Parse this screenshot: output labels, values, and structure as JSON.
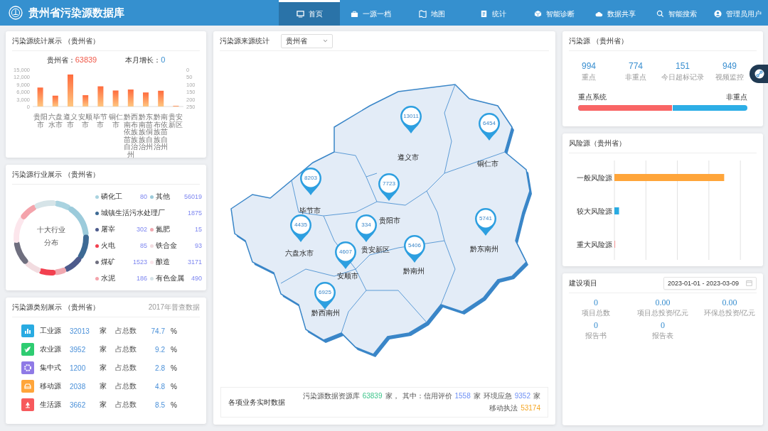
{
  "header": {
    "title": "贵州省污染源数据库",
    "nav": [
      {
        "label": "首页",
        "selected": true
      },
      {
        "label": "一源一档",
        "selected": false
      },
      {
        "label": "地图",
        "selected": false
      },
      {
        "label": "统计",
        "selected": false
      },
      {
        "label": "智能诊断",
        "selected": false
      },
      {
        "label": "数据共享",
        "selected": false
      },
      {
        "label": "智能搜索",
        "selected": false
      },
      {
        "label": "管理员用户",
        "selected": false
      }
    ]
  },
  "source_stats": {
    "title": "污染源统计展示 （贵州省）",
    "total_label": "贵州省：",
    "total": "63839",
    "growth_label": "本月增长：",
    "growth": "0",
    "chart_data": {
      "type": "bar",
      "categories": [
        "贵阳市",
        "六盘水市",
        "遵义市",
        "安顺市",
        "毕节市",
        "铜仁市",
        "黔西南布依族苗族自治州",
        "黔东南苗族侗族自治州",
        "黔南布依族苗族自治州",
        "贵安新区"
      ],
      "values": [
        7700,
        4400,
        13000,
        4600,
        8200,
        6500,
        6900,
        5700,
        6400,
        300
      ],
      "ylim": [
        0,
        15000
      ],
      "yticks": [
        {
          "value": 0,
          "label": "0"
        },
        {
          "value": 3000,
          "label": "3,000"
        },
        {
          "value": 6000,
          "label": "6,000"
        },
        {
          "value": 9000,
          "label": "9,000"
        },
        {
          "value": 12000,
          "label": "12,000"
        },
        {
          "value": 15000,
          "label": "15,000"
        }
      ]
    },
    "right_axis_ticks": [
      "0",
      "50",
      "100",
      "150",
      "200",
      "250"
    ]
  },
  "industry": {
    "title": "污染源行业展示 （贵州省）",
    "center_label": [
      "十大行业",
      "分布"
    ],
    "legend_rows": [
      [
        {
          "name": "磷化工",
          "value": "80",
          "color": "#a9d3e0"
        },
        {
          "name": "其他",
          "value": "56019",
          "color": "#9ccbdb"
        }
      ],
      [
        {
          "name": "城镇生活污水处理厂",
          "value": "1875",
          "color": "#3d6a94"
        }
      ],
      [
        {
          "name": "屠宰",
          "value": "302",
          "color": "#4d5b8c"
        },
        {
          "name": "氮肥",
          "value": "15",
          "color": "#f0a8b0"
        }
      ],
      [
        {
          "name": "火电",
          "value": "85",
          "color": "#f2404f"
        },
        {
          "name": "铁合金",
          "value": "93",
          "color": "#f2dce0"
        }
      ],
      [
        {
          "name": "煤矿",
          "value": "1523",
          "color": "#6f6f7f"
        },
        {
          "name": "酿造",
          "value": "3171",
          "color": "#fce6ec"
        }
      ],
      [
        {
          "name": "水泥",
          "value": "186",
          "color": "#f4a3ab"
        },
        {
          "name": "有色金属",
          "value": "490",
          "color": "#d6e4e8"
        }
      ]
    ]
  },
  "categories": {
    "title": "污染源类别展示 （贵州省）",
    "note": "2017年普查数据",
    "items": [
      {
        "name": "工业源",
        "count": "32013",
        "unit": "家",
        "share_label": "占总数",
        "share": "74.7",
        "percent": "%",
        "color": "#29abe2"
      },
      {
        "name": "农业源",
        "count": "3952",
        "unit": "家",
        "share_label": "占总数",
        "share": "9.2",
        "percent": "%",
        "color": "#2ecc71"
      },
      {
        "name": "集中式",
        "count": "1200",
        "unit": "家",
        "share_label": "占总数",
        "share": "2.8",
        "percent": "%",
        "color": "#8f7ae6"
      },
      {
        "name": "移动源",
        "count": "2038",
        "unit": "家",
        "share_label": "占总数",
        "share": "4.8",
        "percent": "%",
        "color": "#ffa53a"
      },
      {
        "name": "生活源",
        "count": "3662",
        "unit": "家",
        "share_label": "占总数",
        "share": "8.5",
        "percent": "%",
        "color": "#f7595c"
      }
    ]
  },
  "map": {
    "title": "污染源来源统计",
    "region_select": "贵州省",
    "cities": [
      {
        "name": "遵义市",
        "count": "13011"
      },
      {
        "name": "铜仁市",
        "count": "6454"
      },
      {
        "name": "毕节市",
        "count": "8203"
      },
      {
        "name": "贵阳市",
        "count": "7723"
      },
      {
        "name": "六盘水市",
        "count": "4435"
      },
      {
        "name": "贵安新区",
        "count": "334"
      },
      {
        "name": "安顺市",
        "count": "4607"
      },
      {
        "name": "黔南州",
        "count": "5406"
      },
      {
        "name": "黔东南州",
        "count": "5741"
      },
      {
        "name": "黔西南州",
        "count": "6925"
      }
    ],
    "footer": {
      "label": "各项业务实时数据",
      "items": [
        {
          "label": "污染源数据资源库",
          "value": "63839",
          "unit": "家，",
          "color": "#3cc48a"
        },
        {
          "label": "其中：信用评价",
          "value": "1558",
          "unit": "家",
          "color": "#6c8ff5"
        },
        {
          "label": "环境应急",
          "value": "9352",
          "unit": "家",
          "color": "#6c8ff5"
        },
        {
          "label": "移动执法",
          "value": "53174",
          "color": "#f5a623"
        }
      ]
    }
  },
  "pollution_sources": {
    "title": "污染源 （贵州省）",
    "stats": [
      {
        "value": "994",
        "label": "重点"
      },
      {
        "value": "774",
        "label": "非重点"
      },
      {
        "value": "151",
        "label": "今日超标记录"
      },
      {
        "value": "949",
        "label": "视频监控"
      }
    ],
    "bar": {
      "left_label": "重点系统",
      "right_label": "非重点",
      "level": 0.56
    }
  },
  "risk": {
    "title": "风险源（贵州省）",
    "bars": [
      {
        "label": "一般风险源",
        "color": "#ffa53a"
      },
      {
        "label": "较大风险源",
        "color": "#29abe2"
      },
      {
        "label": "重大风险源",
        "color": "#f7a0a0"
      }
    ]
  },
  "projects": {
    "title": "建设项目",
    "date_range": "2023-01-01 - 2023-03-09",
    "stats": [
      [
        {
          "value": "0",
          "label": "项目总数"
        },
        {
          "value": "0.00",
          "label": "项目总投资/亿元"
        },
        {
          "value": "0.00",
          "label": "环保总投资/亿元"
        }
      ],
      [
        {
          "value": "0",
          "label": "报告书"
        },
        {
          "value": "0",
          "label": "报告表"
        }
      ]
    ]
  }
}
